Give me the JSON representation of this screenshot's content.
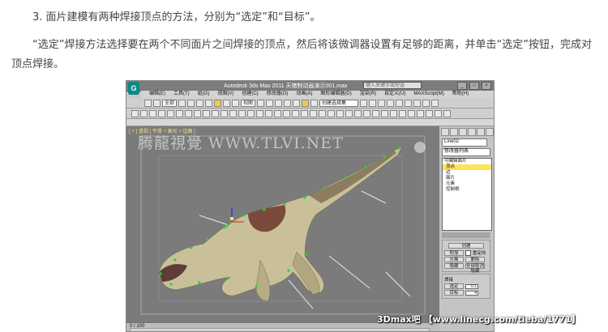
{
  "article": {
    "step_heading": "3. 面片建模有两种焊接顶点的方法，分别为“选定”和“目标”。",
    "paragraph": "“选定”焊接方法选择要在两个不同面片之间焊接的顶点，然后将该微调器设置有足够的距离，并单击“选定”按钮，完成对顶点焊接。"
  },
  "screenshot": {
    "logo": "G",
    "title": "Autodesk 3ds Max  2011     天猪制动画演示001.max",
    "search_placeholder": "键入关键字或短语",
    "window_buttons": [
      "_",
      "□",
      "×"
    ],
    "menu": [
      "编辑(E)",
      "工具(T)",
      "组(G)",
      "视图(V)",
      "创建(C)",
      "修改器(O)",
      "动画(A)",
      "图形编辑器(D)",
      "渲染(R)",
      "自定义(U)",
      "MAXScript(M)",
      "帮助(H)"
    ],
    "toolbar_combo_select": "全部",
    "toolbar_combo_view": "视图",
    "toolbar_combo_selset": "创建选择集",
    "viewport_label": "[ + ] 透视 [ 平滑 + 高光 + 边面 ]",
    "watermark": "腾龍視覺 WWW.TLVI.NET",
    "object_name": "Line02",
    "modifier_list": "修改器列表",
    "stack": [
      {
        "label": "可编辑面片",
        "selected": false,
        "root": true
      },
      {
        "label": "顶点",
        "selected": true,
        "root": false
      },
      {
        "label": "边",
        "selected": false,
        "root": false
      },
      {
        "label": "面片",
        "selected": false,
        "root": false
      },
      {
        "label": "元素",
        "selected": false,
        "root": false
      },
      {
        "label": "控制柄",
        "selected": false,
        "root": false
      }
    ],
    "panel_buttons": {
      "create": "创建",
      "weld": "附加",
      "reorient": "重定向",
      "detach": "分离",
      "hide": "隐藏",
      "unhide_all": "全部取消隐藏",
      "select": "选定",
      "target": "目标",
      "delete": "删除"
    },
    "weld_group_title": "焊接",
    "select_threshold": "0.1",
    "target_threshold": "4",
    "status_coord": "0 / 100",
    "forum_caption": "3Dmax吧  【www.linecg.com/tieba/1771】"
  },
  "colors": {
    "selection_yellow": "#ffe35a",
    "viewport_bg": "#7b7b7b",
    "logo_teal": "#0b8a86"
  }
}
